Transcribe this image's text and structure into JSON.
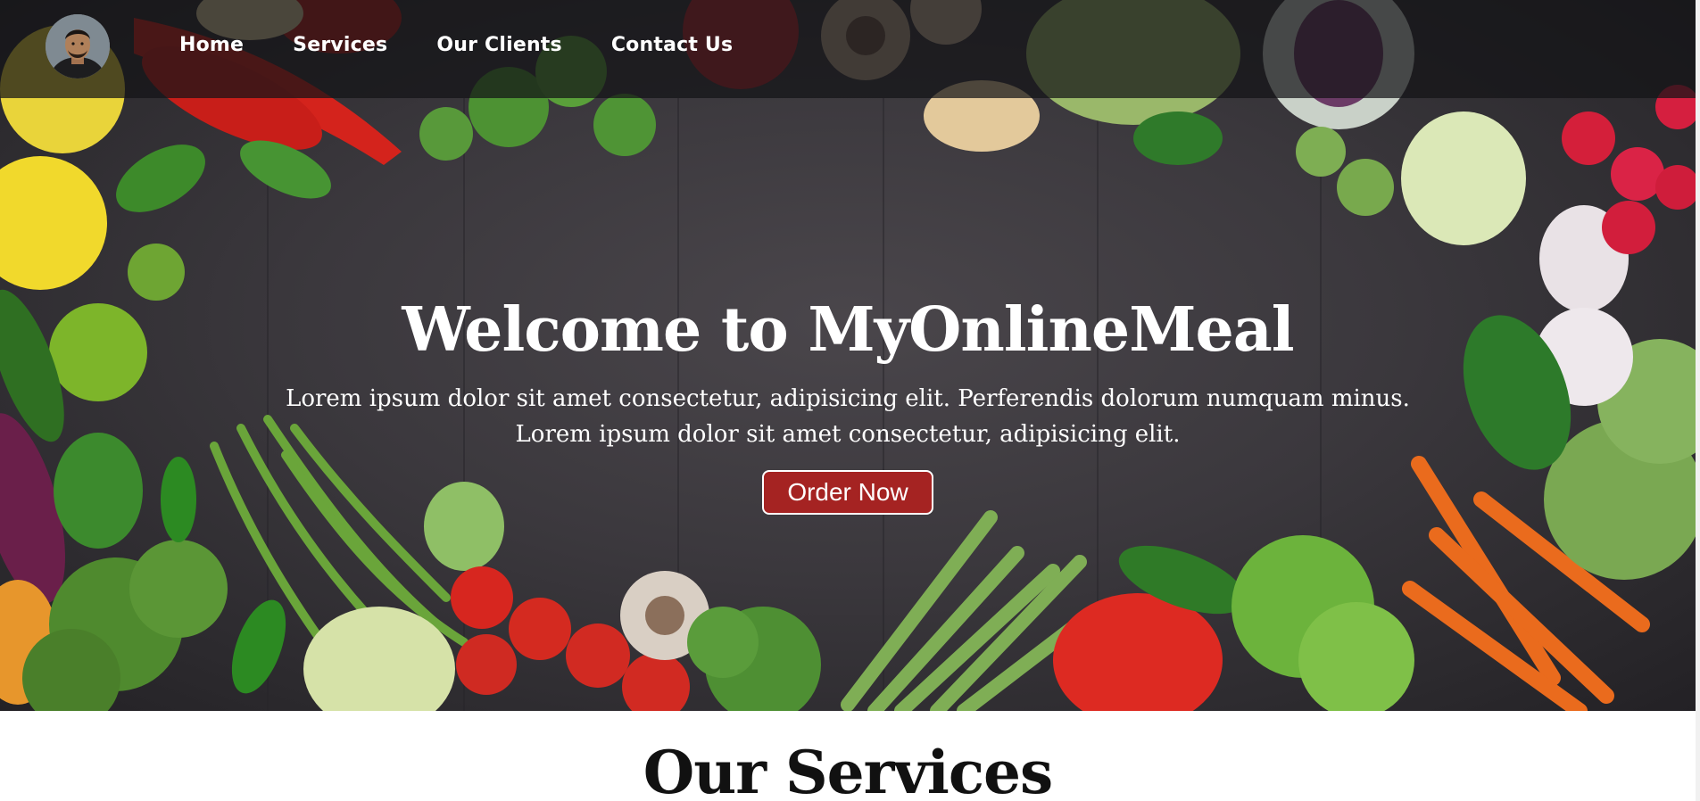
{
  "nav": {
    "items": [
      {
        "label": "Home"
      },
      {
        "label": "Services"
      },
      {
        "label": "Our Clients"
      },
      {
        "label": "Contact Us"
      }
    ]
  },
  "hero": {
    "title": "Welcome to MyOnlineMeal",
    "subtitle": "Lorem ipsum dolor sit amet consectetur, adipisicing elit. Perferendis dolorum numquam minus. Lorem ipsum dolor sit amet consectetur, adipisicing elit.",
    "cta_label": "Order Now",
    "background_image": "vegetables-on-dark-table"
  },
  "services": {
    "title": "Our Services"
  },
  "colors": {
    "cta_background": "#a52322",
    "navbar_background": "rgba(20,20,22,0.72)",
    "text_light": "#ffffff",
    "text_dark": "#111111"
  }
}
